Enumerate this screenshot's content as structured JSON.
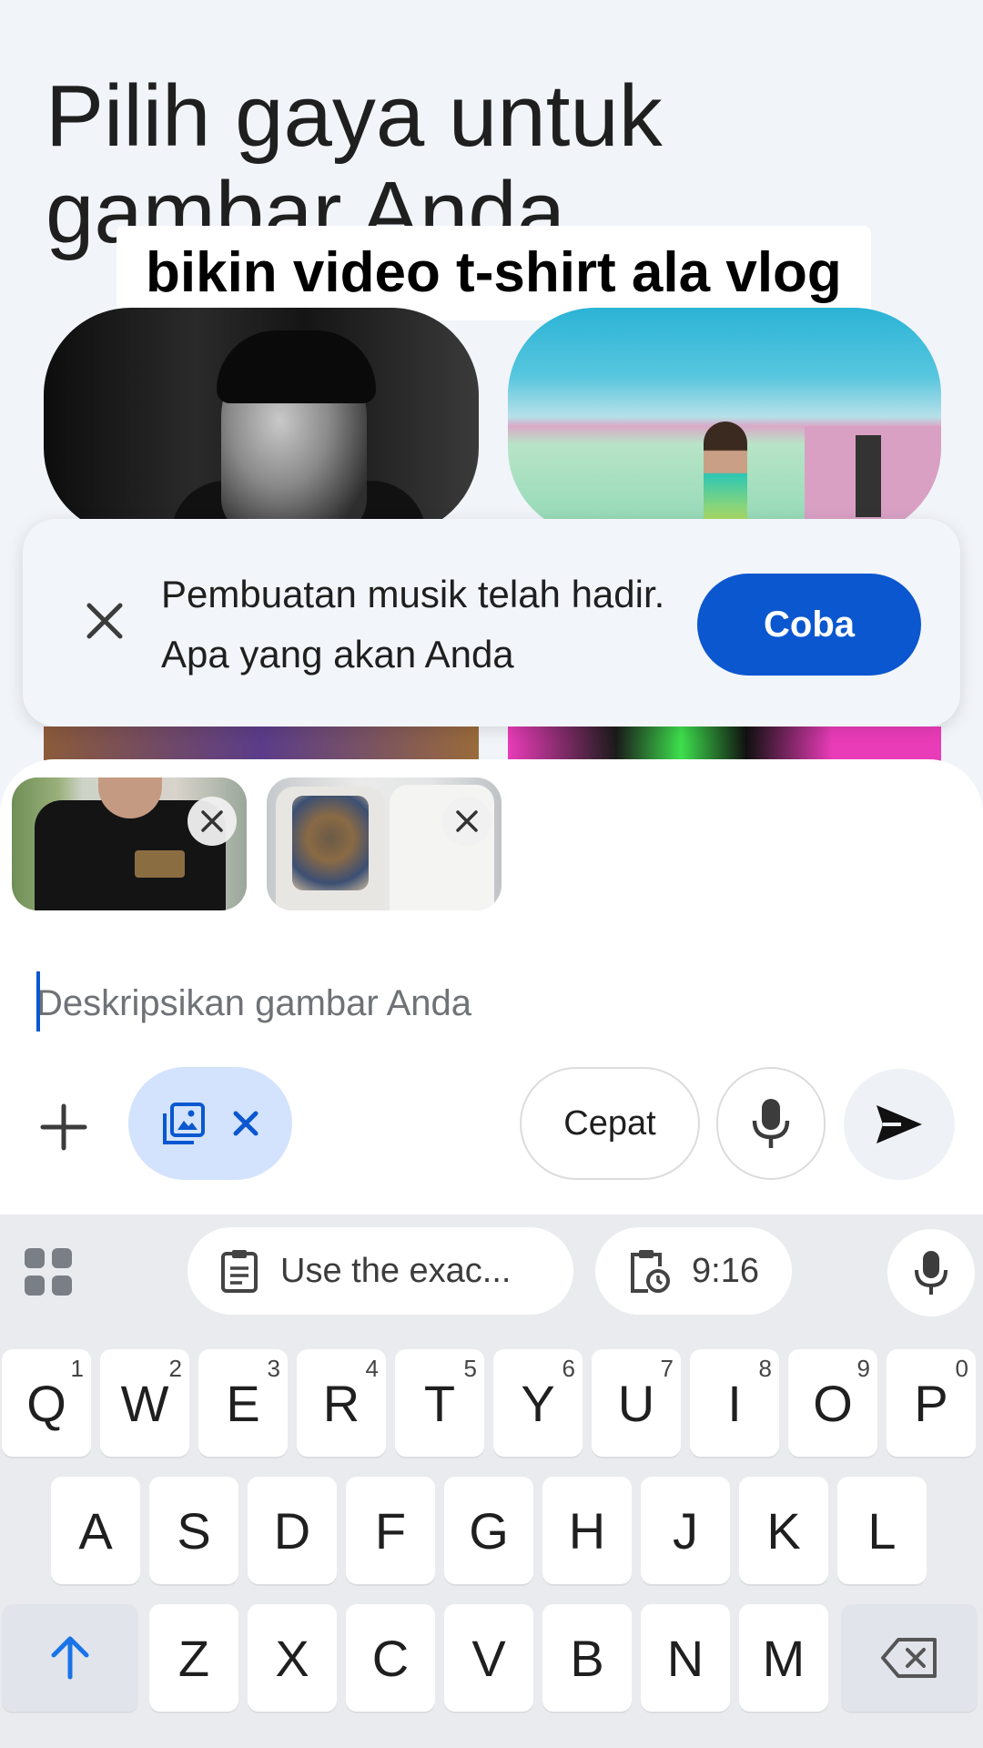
{
  "title": "Pilih gaya untuk gambar Anda",
  "overlay_caption": "bikin video t-shirt ala vlog",
  "banner": {
    "text": "Pembuatan musik telah hadir. Apa yang akan Anda",
    "button_label": "Coba"
  },
  "composer": {
    "placeholder": "Deskripsikan gambar Anda",
    "speed_label": "Cepat"
  },
  "keyboard": {
    "suggestions": [
      {
        "icon": "clipboard-icon",
        "label": "Use the exac..."
      },
      {
        "icon": "clipboard-clock-icon",
        "label": "9:16"
      }
    ],
    "row1": [
      {
        "key": "Q",
        "hint": "1"
      },
      {
        "key": "W",
        "hint": "2"
      },
      {
        "key": "E",
        "hint": "3"
      },
      {
        "key": "R",
        "hint": "4"
      },
      {
        "key": "T",
        "hint": "5"
      },
      {
        "key": "Y",
        "hint": "6"
      },
      {
        "key": "U",
        "hint": "7"
      },
      {
        "key": "I",
        "hint": "8"
      },
      {
        "key": "O",
        "hint": "9"
      },
      {
        "key": "P",
        "hint": "0"
      }
    ],
    "row2": [
      "A",
      "S",
      "D",
      "F",
      "G",
      "H",
      "J",
      "K",
      "L"
    ],
    "row3": [
      "Z",
      "X",
      "C",
      "V",
      "B",
      "N",
      "M"
    ]
  },
  "colors": {
    "accent": "#0b57d0",
    "chip_bg": "#d3e3fd",
    "background": "#f1f4f9",
    "shift_arrow": "#1a73e8"
  }
}
